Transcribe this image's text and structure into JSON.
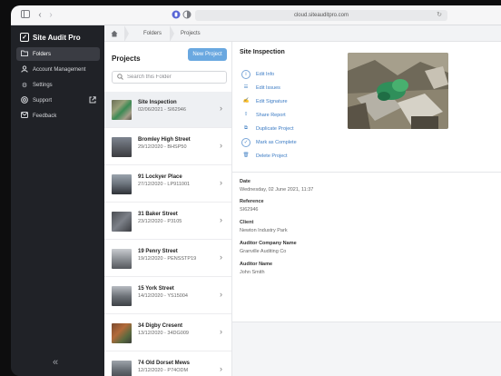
{
  "browser": {
    "url": "cloud.siteauditpro.com",
    "icons": [
      "sidebar-toggle-icon",
      "back-icon",
      "forward-icon",
      "privacy-icon",
      "reader-icon",
      "lock-icon",
      "reload-icon"
    ]
  },
  "app": {
    "name": "Site Audit Pro",
    "nav": [
      {
        "label": "Folders",
        "icon": "folder-icon",
        "active": true
      },
      {
        "label": "Account Management",
        "icon": "user-icon",
        "active": false
      },
      {
        "label": "Settings",
        "icon": "gear-icon",
        "active": false
      },
      {
        "label": "Support",
        "icon": "help-icon",
        "active": false,
        "external": true
      },
      {
        "label": "Feedback",
        "icon": "message-icon",
        "active": false
      }
    ],
    "collapse_glyph": "«"
  },
  "breadcrumb": [
    "Folders",
    "Projects"
  ],
  "projects": {
    "title": "Projects",
    "new_button": "New Project",
    "search_placeholder": "Search this Folder",
    "items": [
      {
        "title": "Site Inspection",
        "subtitle": "02/06/2021 - SI62946",
        "selected": true
      },
      {
        "title": "Bromley High Street",
        "subtitle": "29/12/2020 - BHSP50",
        "selected": false
      },
      {
        "title": "91 Lockyer Place",
        "subtitle": "27/12/2020 - LP911001",
        "selected": false
      },
      {
        "title": "31 Baker Street",
        "subtitle": "23/12/2020 - P3105",
        "selected": false
      },
      {
        "title": "19 Penry Street",
        "subtitle": "19/12/2020 - PENSSTP19",
        "selected": false
      },
      {
        "title": "15 York Street",
        "subtitle": "14/12/2020 - YS15004",
        "selected": false
      },
      {
        "title": "34 Digby Cresent",
        "subtitle": "13/12/2020 - 34DG009",
        "selected": false
      },
      {
        "title": "74 Old Dorset Mews",
        "subtitle": "12/12/2020 - P74ODM",
        "selected": false
      }
    ]
  },
  "detail": {
    "title": "Site Inspection",
    "actions": [
      {
        "label": "Edit Info",
        "icon": "info-icon"
      },
      {
        "label": "Edit Issues",
        "icon": "list-icon"
      },
      {
        "label": "Edit Signature",
        "icon": "signature-icon"
      },
      {
        "label": "Share Report",
        "icon": "share-icon"
      },
      {
        "label": "Duplicate Project",
        "icon": "duplicate-icon"
      },
      {
        "label": "Mark as Complete",
        "icon": "check-icon"
      },
      {
        "label": "Delete Project",
        "icon": "trash-icon"
      }
    ],
    "fields": [
      {
        "label": "Date",
        "value": "Wednesday, 02 June 2021, 11:37"
      },
      {
        "label": "Reference",
        "value": "SI62946"
      },
      {
        "label": "Client",
        "value": "Newton Industry Park"
      },
      {
        "label": "Auditor Company Name",
        "value": "Granville Auditing Co"
      },
      {
        "label": "Auditor Name",
        "value": "John Smith"
      }
    ]
  },
  "colors": {
    "sidebar": "#202227",
    "accent": "#6aa8e0",
    "link": "#3b7bc4"
  }
}
